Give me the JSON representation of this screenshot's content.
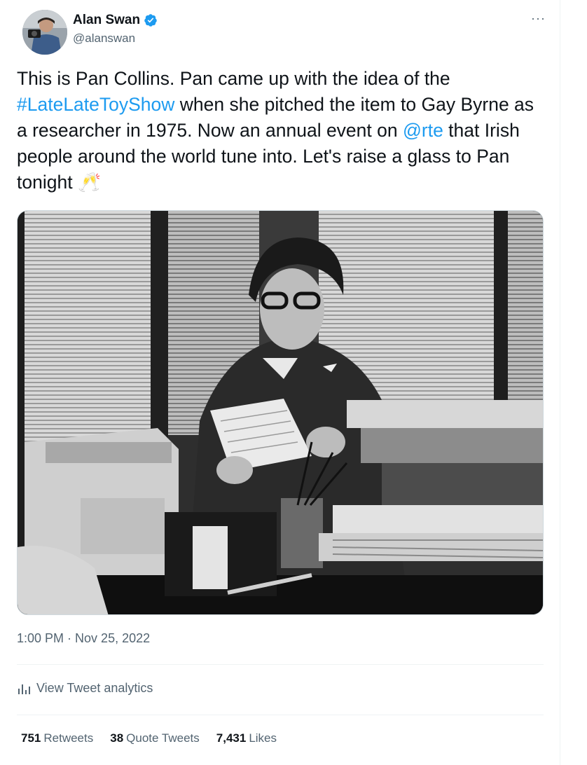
{
  "author": {
    "name": "Alan Swan",
    "handle": "@alanswan",
    "verified": true
  },
  "more_menu": "···",
  "tweet": {
    "segments": [
      {
        "text": "This is Pan Collins. Pan came up with the idea of the ",
        "link": false
      },
      {
        "text": "#LateLateToyShow",
        "link": true
      },
      {
        "text": " when she pitched the item to Gay Byrne as a researcher in 1975. Now an annual event on ",
        "link": false
      },
      {
        "text": "@rte",
        "link": true
      },
      {
        "text": " that Irish people around the world tune into. Let's raise a glass to Pan tonight ",
        "link": false
      },
      {
        "text": "🥂",
        "link": false
      }
    ]
  },
  "timestamp": {
    "time": "1:00 PM",
    "separator": " · ",
    "date": "Nov 25, 2022"
  },
  "analytics": {
    "label": "View Tweet analytics",
    "icon": "bar-chart-icon"
  },
  "stats": {
    "retweets": {
      "count": "751",
      "label": "Retweets"
    },
    "quotes": {
      "count": "38",
      "label": "Quote Tweets"
    },
    "likes": {
      "count": "7,431",
      "label": "Likes"
    }
  },
  "colors": {
    "link": "#1d9bf0",
    "text": "#0f1419",
    "secondary": "#536471",
    "divider": "#eff3f4"
  }
}
